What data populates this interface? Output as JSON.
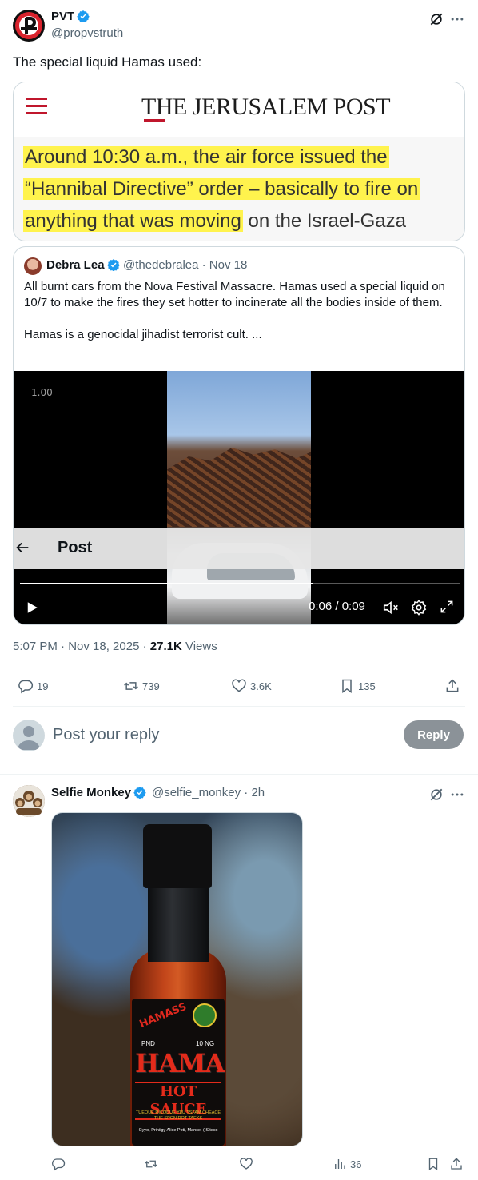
{
  "tweet": {
    "author_name": "PVT",
    "author_handle": "@propvstruth",
    "text": "The special liquid Hamas used:",
    "timestamp": "5:07 PM · Nov 18, 2025 · ",
    "views_count": "27.1K",
    "views_label": " Views"
  },
  "image_card": {
    "logo": "THE JERUSALEM POST",
    "line1": "Around 10:30 a.m., the air force issued the",
    "line2": "“Hannibal Directive” order – basically to fire on",
    "line3_highlight": "anything that was moving",
    "line3_rest": " on the Israel-Gaza"
  },
  "quote": {
    "author_name": "Debra Lea",
    "author_handle": "@thedebralea",
    "date": " · Nov 18",
    "paragraph1": "All burnt cars from the Nova Festival Massacre. Hamas used a special liquid on 10/7 to make the fires they set hotter to incinerate all the bodies inside of them.",
    "paragraph2": "Hamas is a genocidal jihadist terrorist cult. ..."
  },
  "video": {
    "speed": "1.00",
    "overlay_title": "Post",
    "time": "0:06 / 0:09",
    "progress": 0.6667
  },
  "actions": {
    "replies": "19",
    "reposts": "739",
    "likes": "3.6K",
    "bookmarks": "135"
  },
  "composer": {
    "placeholder": "Post your reply",
    "button": "Reply"
  },
  "reply": {
    "author_name": "Selfie Monkey",
    "author_handle": "@selfie_monkey",
    "time": " · 2h",
    "views": "36",
    "image_label": {
      "brand": "HAMASS",
      "pnd": "PND",
      "ng": "10 NG",
      "name": "HAMAS",
      "subtitle": "HOT SAUCE",
      "small1": "TUEQUE RICODUE YIIU TSFAM CHEACE THE SPON DOT TAEKS",
      "small2": "Cyyo, Priniigy Alice Poti, Mance. ( Sitecc"
    }
  },
  "colors": {
    "accent": "#1d9bf0",
    "highlight": "#fff34d",
    "jp_red": "#c0162c"
  },
  "icons": [
    "verified-icon",
    "grok-icon",
    "more-icon",
    "back-arrow-icon",
    "play-icon",
    "mute-icon",
    "settings-icon",
    "fullscreen-icon",
    "reply-icon",
    "repost-icon",
    "like-icon",
    "bookmark-icon",
    "share-icon",
    "views-icon",
    "menu-icon"
  ]
}
